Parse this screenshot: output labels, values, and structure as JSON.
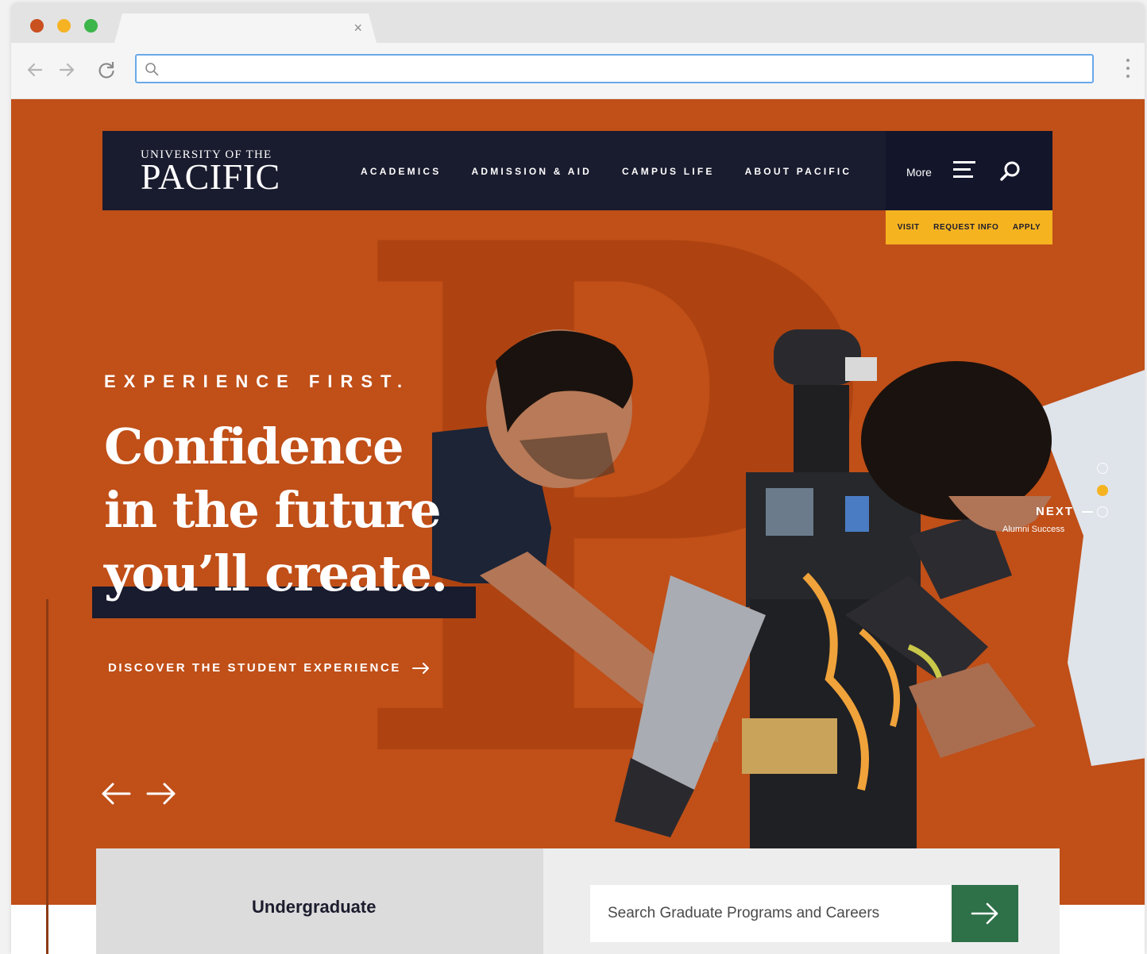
{
  "browser": {
    "tab_close_glyph": "×",
    "address_bar": {
      "value": "",
      "placeholder": ""
    }
  },
  "site": {
    "logo": {
      "top": "UNIVERSITY OF THE",
      "main": "PACIFIC"
    },
    "nav": [
      "ACADEMICS",
      "ADMISSION & AID",
      "CAMPUS LIFE",
      "ABOUT PACIFIC"
    ],
    "more_label": "More",
    "utility": [
      "VISIT",
      "REQUEST INFO",
      "APPLY"
    ],
    "colors": {
      "accent": "#f5b320",
      "hero_bg": "#c04f18",
      "navy": "#191b2e",
      "green": "#2e7048"
    }
  },
  "hero": {
    "background_letter": "P",
    "eyebrow": "EXPERIENCE FIRST.",
    "headline_line1": "Confidence",
    "headline_line2": "in the future",
    "headline_line3": "you’ll create.",
    "cta": "DISCOVER THE STUDENT EXPERIENCE",
    "next_label": "NEXT",
    "next_sub": "Alumni Success"
  },
  "programs": {
    "undergraduate_label": "Undergraduate",
    "graduate_search_placeholder": "Search Graduate Programs and Careers"
  },
  "icons": [
    "search-icon",
    "back-arrow-icon",
    "forward-arrow-icon",
    "reload-icon",
    "kebab-menu-icon",
    "hamburger-icon",
    "arrow-right-icon",
    "arrow-left-icon"
  ]
}
